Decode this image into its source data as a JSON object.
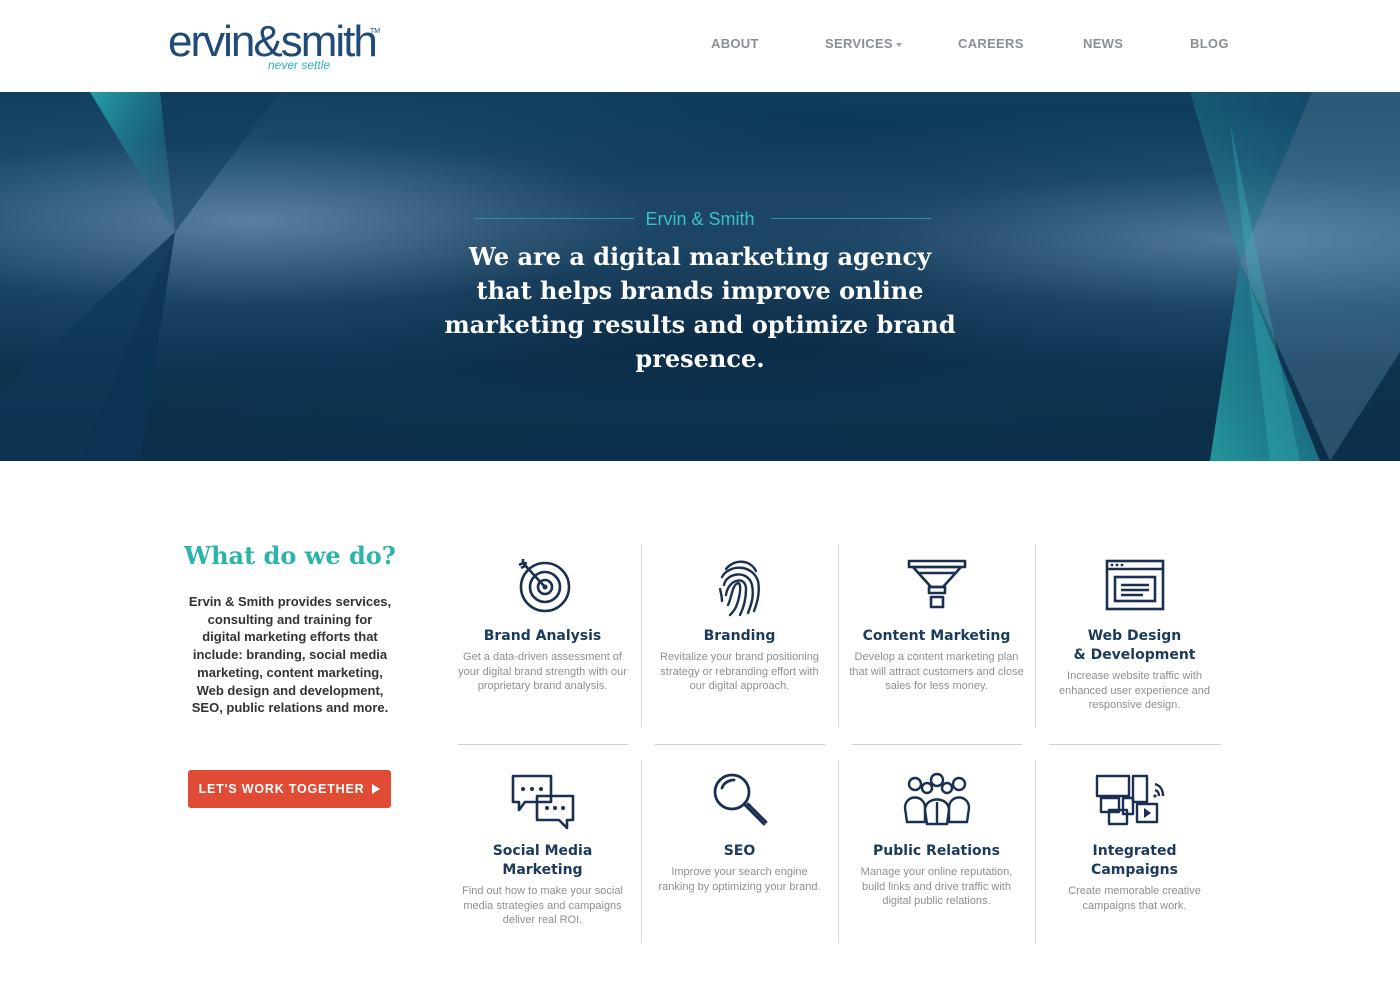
{
  "header": {
    "logo_wordmark": "ervin&smith",
    "logo_tagline": "never settle",
    "logo_tm": "TM",
    "nav": [
      {
        "label": "ABOUT"
      },
      {
        "label": "SERVICES",
        "has_dropdown": true
      },
      {
        "label": "CAREERS"
      },
      {
        "label": "NEWS"
      },
      {
        "label": "BLOG"
      }
    ]
  },
  "hero": {
    "eyebrow": "Ervin & Smith",
    "headline": "We are a digital marketing agency that helps brands improve online marketing results and optimize brand presence."
  },
  "intro": {
    "title": "What do we do?",
    "text": "Ervin & Smith provides services, consulting and training for digital marketing efforts that include: branding, social media marketing, content marketing, Web design and development, SEO, public relations and more.",
    "cta_label": "LET'S WORK TOGETHER"
  },
  "services": [
    {
      "icon": "target-icon",
      "title": "Brand Analysis",
      "desc": "Get a data-driven assessment of your digital brand strength with our proprietary brand analysis."
    },
    {
      "icon": "fingerprint-icon",
      "title": "Branding",
      "desc": "Revitalize your brand positioning strategy or rebranding effort with our digital approach."
    },
    {
      "icon": "funnel-icon",
      "title": "Content Marketing",
      "desc": "Develop a content marketing plan that will attract customers and close sales for less money."
    },
    {
      "icon": "browser-window-icon",
      "title": "Web Design\n& Development",
      "desc": "Increase website traffic with enhanced user experience and responsive design."
    },
    {
      "icon": "chat-bubbles-icon",
      "title": "Social Media Marketing",
      "desc": "Find out how to make your social media strategies and campaigns deliver real ROI."
    },
    {
      "icon": "magnifier-icon",
      "title": "SEO",
      "desc": "Improve your search engine ranking by optimizing your brand."
    },
    {
      "icon": "people-group-icon",
      "title": "Public Relations",
      "desc": "Manage your online reputation, build links and drive traffic with digital public relations."
    },
    {
      "icon": "devices-icon",
      "title": "Integrated Campaigns",
      "desc": "Create memorable creative campaigns that work."
    }
  ],
  "colors": {
    "brand_navy": "#1f4a7a",
    "accent_teal": "#2bb4aa",
    "cta_red": "#e04b35",
    "icon_navy": "#1a2f52"
  }
}
